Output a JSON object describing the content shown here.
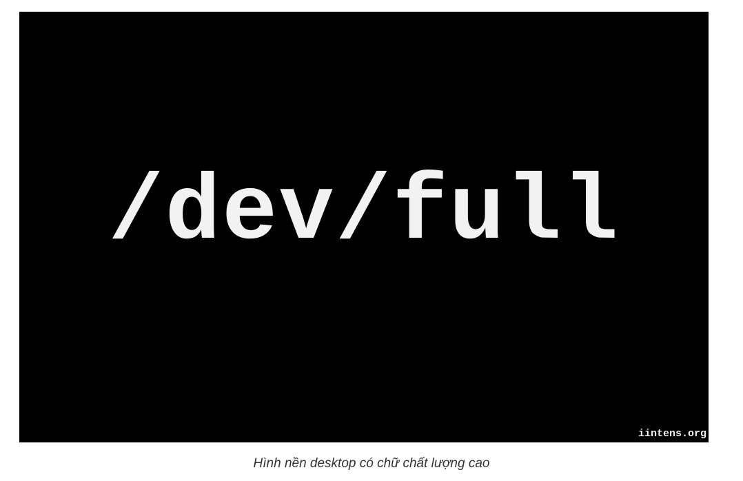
{
  "image": {
    "headline": "/dev/full",
    "watermark": "iintens.org",
    "background_color": "#000000",
    "text_color": "#f2f2f2"
  },
  "caption": "Hình nền desktop có chữ chất lượng cao"
}
